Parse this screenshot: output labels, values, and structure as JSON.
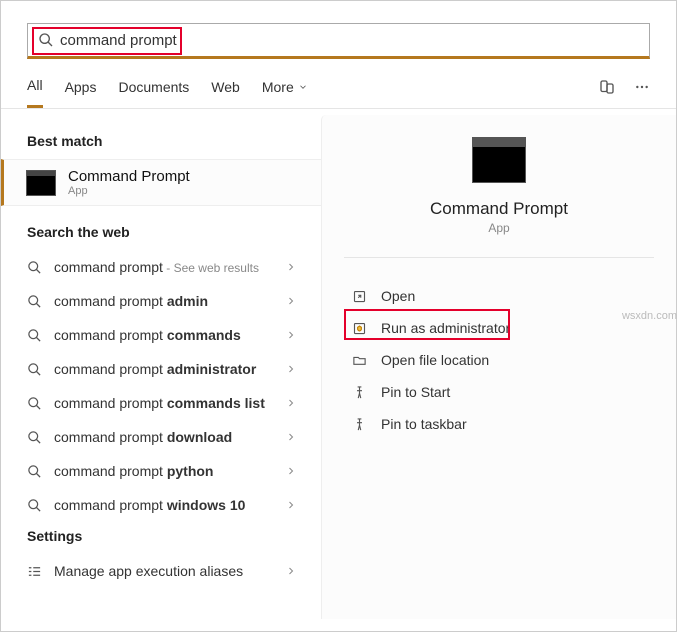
{
  "search": {
    "value": "command prompt"
  },
  "tabs": {
    "all": "All",
    "apps": "Apps",
    "documents": "Documents",
    "web": "Web",
    "more": "More"
  },
  "left": {
    "best_match_header": "Best match",
    "best_match": {
      "title": "Command Prompt",
      "subtitle": "App"
    },
    "web_header": "Search the web",
    "web_items": [
      {
        "prefix": "command prompt",
        "bold": "",
        "hint": " - See web results"
      },
      {
        "prefix": "command prompt ",
        "bold": "admin",
        "hint": ""
      },
      {
        "prefix": "command prompt ",
        "bold": "commands",
        "hint": ""
      },
      {
        "prefix": "command prompt ",
        "bold": "administrator",
        "hint": ""
      },
      {
        "prefix": "command prompt ",
        "bold": "commands list",
        "hint": ""
      },
      {
        "prefix": "command prompt ",
        "bold": "download",
        "hint": ""
      },
      {
        "prefix": "command prompt ",
        "bold": "python",
        "hint": ""
      },
      {
        "prefix": "command prompt ",
        "bold": "windows 10",
        "hint": ""
      }
    ],
    "settings_header": "Settings",
    "settings_item": "Manage app execution aliases"
  },
  "right": {
    "title": "Command Prompt",
    "subtitle": "App",
    "actions": {
      "open": "Open",
      "run_admin": "Run as administrator",
      "open_location": "Open file location",
      "pin_start": "Pin to Start",
      "pin_taskbar": "Pin to taskbar"
    }
  },
  "watermark": "wsxdn.com"
}
